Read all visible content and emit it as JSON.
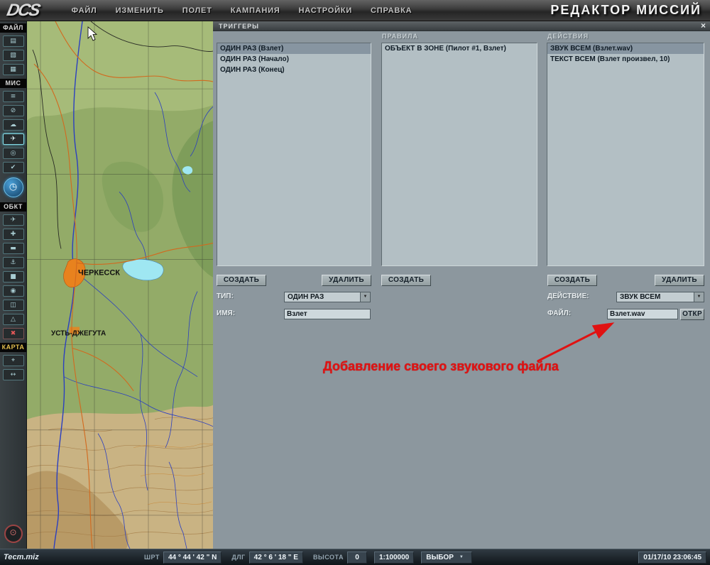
{
  "colors": {
    "annotation_red": "#e01212",
    "panel_bg": "#8c979e",
    "list_bg": "#b3bfc4",
    "selected_bg": "#8795a1",
    "sidebar_teal": "#53767c"
  },
  "icons": {
    "dropdown_arrow": "▼",
    "close": "×"
  },
  "top_bar": {
    "logo": "DCS",
    "menus": [
      "ФАЙЛ",
      "ИЗМЕНИТЬ",
      "ПОЛЕТ",
      "КАМПАНИЯ",
      "НАСТРОЙКИ",
      "СПРАВКА"
    ],
    "title": "РЕДАКТОР МИССИЙ"
  },
  "sidebar": {
    "sections": [
      {
        "label": "ФАЙЛ"
      },
      {
        "label": "МИС"
      },
      {
        "label": "ОБКТ"
      },
      {
        "label": "КАРТА"
      }
    ],
    "file_icons": [
      {
        "name": "new-mission",
        "glyph": "▤"
      },
      {
        "name": "open-mission",
        "glyph": "▧"
      },
      {
        "name": "save-mission",
        "glyph": "▦"
      }
    ],
    "mis_icons": [
      {
        "name": "briefing",
        "glyph": "≡"
      },
      {
        "name": "restrictions",
        "glyph": "⊘"
      },
      {
        "name": "weather",
        "glyph": "☁"
      },
      {
        "name": "aircraft-route",
        "glyph": "✈"
      },
      {
        "name": "goals",
        "glyph": "◎"
      },
      {
        "name": "check",
        "glyph": "✔"
      }
    ],
    "time_icon": {
      "name": "mission-time",
      "glyph": "◷"
    },
    "obkt_icons": [
      {
        "name": "airplane",
        "glyph": "✈"
      },
      {
        "name": "helicopter",
        "glyph": "✚"
      },
      {
        "name": "ground-vehicle",
        "glyph": "▬"
      },
      {
        "name": "ship",
        "glyph": "⚓"
      },
      {
        "name": "static-object",
        "glyph": "■"
      },
      {
        "name": "airbase",
        "glyph": "◉"
      },
      {
        "name": "template-group",
        "glyph": "◫"
      },
      {
        "name": "trigger-zones",
        "glyph": "△"
      },
      {
        "name": "remove-object",
        "glyph": "✖"
      }
    ],
    "karta_icons": [
      {
        "name": "map-search",
        "glyph": "⌖"
      },
      {
        "name": "map-measure",
        "glyph": "↔"
      }
    ],
    "exit_icon": {
      "name": "exit",
      "glyph": "⊙"
    }
  },
  "map": {
    "city1": "ЧЕРКЕССК",
    "city2": "УСТЬ-ДЖЕГУТА"
  },
  "panel": {
    "title": "ТРИГГЕРЫ",
    "rules_header": "ПРАВИЛА",
    "actions_header": "ДЕЙСТВИЯ",
    "triggers": {
      "items": [
        {
          "label": "ОДИН РАЗ (Взлет)"
        },
        {
          "label": "ОДИН РАЗ (Начало)"
        },
        {
          "label": "ОДИН РАЗ (Конец)"
        }
      ]
    },
    "rules": {
      "items": [
        {
          "label": "ОБЪЕКТ В ЗОНЕ (Пилот #1, Взлет)"
        }
      ]
    },
    "actions": {
      "items": [
        {
          "label": "ЗВУК ВСЕМ (Взлет.wav)"
        },
        {
          "label": "ТЕКСТ ВСЕМ (Взлет произвел, 10)"
        }
      ]
    },
    "buttons": {
      "create": "СОЗДАТЬ",
      "delete": "УДАЛИТЬ",
      "open": "ОТКР"
    },
    "form": {
      "type_label": "ТИП:",
      "type_value": "ОДИН РАЗ",
      "name_label": "ИМЯ:",
      "name_value": "Взлет",
      "action_label": "ДЕЙСТВИЕ:",
      "action_value": "ЗВУК ВСЕМ",
      "file_label": "ФАЙЛ:",
      "file_value": "Взлет.wav"
    },
    "annotation": "Добавление своего звукового файла"
  },
  "status_bar": {
    "file": "Тест.miz",
    "lat_label": "ШРТ",
    "lat_value": "44 ° 44 ' 42 \" N",
    "lon_label": "ДЛГ",
    "lon_value": "42 ° 6 ' 18 \" E",
    "alt_label": "ВЫСОТА",
    "alt_value": "0",
    "scale": "1:100000",
    "mode": "ВЫБОР",
    "datetime": "01/17/10 23:06:45"
  }
}
